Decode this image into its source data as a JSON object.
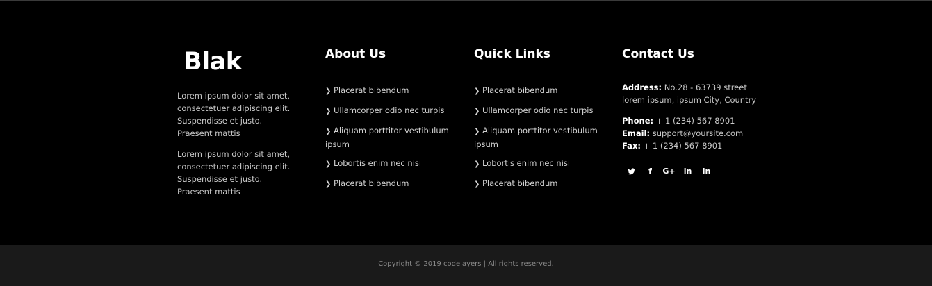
{
  "brand": {
    "logo": "Blak",
    "paragraphs": [
      "Lorem ipsum dolor sit amet, consectetuer adipiscing elit. Suspendisse et justo. Praesent mattis",
      "Lorem ipsum dolor sit amet, consectetuer adipiscing elit. Suspendisse et justo. Praesent mattis"
    ]
  },
  "about": {
    "heading": "About Us",
    "items": [
      {
        "label": "Placerat bibendum"
      },
      {
        "label": "Ullamcorper odio nec turpis"
      },
      {
        "label": "Aliquam porttitor vestibulum ipsum"
      },
      {
        "label": "Lobortis enim nec nisi"
      },
      {
        "label": "Placerat bibendum"
      }
    ]
  },
  "quick_links": {
    "heading": "Quick Links",
    "items": [
      {
        "label": "Placerat bibendum"
      },
      {
        "label": "Ullamcorper odio nec turpis"
      },
      {
        "label": "Aliquam porttitor vestibulum ipsum"
      },
      {
        "label": "Lobortis enim nec nisi"
      },
      {
        "label": "Placerat bibendum"
      }
    ]
  },
  "contact": {
    "heading": "Contact Us",
    "address_label": "Address:",
    "address_value": "No.28 - 63739 street lorem ipsum, ipsum City, Country",
    "phone_label": "Phone:",
    "phone_value": "+ 1 (234) 567 8901",
    "email_label": "Email:",
    "email_value": "support@yoursite.com",
    "fax_label": "Fax:",
    "fax_value": "+ 1 (234) 567 8901",
    "social": [
      {
        "icon": "twitter-icon",
        "glyph": "🐦"
      },
      {
        "icon": "facebook-icon",
        "glyph": "f"
      },
      {
        "icon": "google-plus-icon",
        "glyph": "G+"
      },
      {
        "icon": "linkedin-icon",
        "glyph": "in"
      },
      {
        "icon": "linkedin-icon",
        "glyph": "in"
      }
    ]
  },
  "copyright": "Copyright © 2019 codelayers | All rights reserved.",
  "colors": {
    "background": "#000000",
    "copyright_bar": "#1a1a1a",
    "heading": "#ffffff",
    "text": "#c9c9c9"
  }
}
